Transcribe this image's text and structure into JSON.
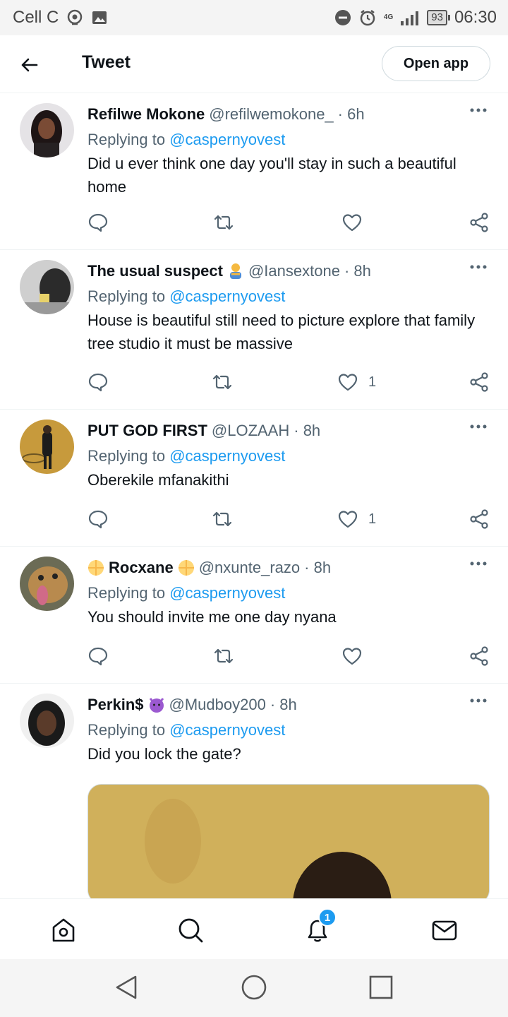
{
  "status_bar": {
    "carrier": "Cell C",
    "network": "4G",
    "battery": "93",
    "time": "06:30"
  },
  "header": {
    "title": "Tweet",
    "open_app_label": "Open app"
  },
  "replying_label": "Replying to",
  "tweets": [
    {
      "name": "Refilwe Mokone",
      "handle": "@refilwemokone_",
      "time": "· 6h",
      "replying_to": "@caspernyovest",
      "text": "Did u ever think one day you'll stay in such a beautiful home",
      "likes": ""
    },
    {
      "name": "The usual suspect",
      "handle": "@Iansextone",
      "time": "· 8h",
      "replying_to": "@caspernyovest",
      "text": "House is beautiful still need to picture explore that family tree studio it must be massive",
      "likes": "1"
    },
    {
      "name": "PUT GOD FIRST",
      "handle": "@LOZAAH",
      "time": "· 8h",
      "replying_to": "@caspernyovest",
      "text": "Oberekile mfanakithi",
      "likes": "1"
    },
    {
      "name": "Rocxane",
      "handle": "@nxunte_razo",
      "time": "· 8h",
      "replying_to": "@caspernyovest",
      "text": "You should invite me one day nyana",
      "likes": ""
    },
    {
      "name": "Perkin$",
      "handle": "@Mudboy200",
      "time": "· 8h",
      "replying_to": "@caspernyovest",
      "text": "Did you lock the gate?",
      "likes": ""
    }
  ],
  "bottom_nav": {
    "notifications_badge": "1"
  },
  "colors": {
    "accent": "#1d9bf0",
    "text": "#0f1419",
    "muted": "#536471"
  }
}
